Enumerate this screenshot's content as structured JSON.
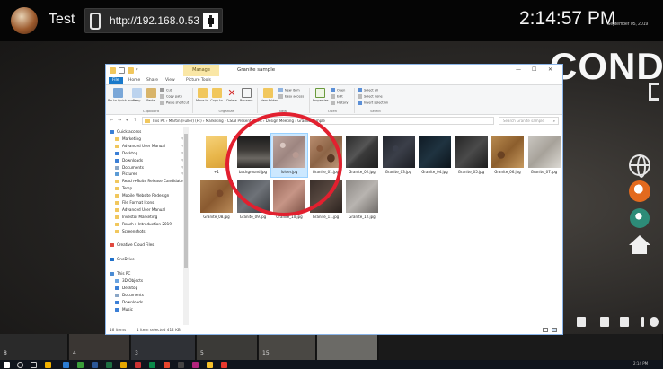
{
  "kiosk": {
    "title": "Test",
    "url": "http://192.168.0.53",
    "clock": "2:14:57 PM",
    "date": "September 05, 2019",
    "brand_text": "COND",
    "icons": {
      "logo": "brand-logo-icon",
      "phone": "phone-icon",
      "qr": "qr-code-icon",
      "globe": "globe-icon",
      "home": "home-icon"
    }
  },
  "thumbstrip": {
    "numbers": [
      "8",
      "4",
      "3",
      "5",
      "15"
    ]
  },
  "taskbar": {
    "time": "2:14 PM"
  },
  "explorer": {
    "window_title": "Granite sample",
    "context_tab": "Manage",
    "ribbon_tabs": [
      "File",
      "Home",
      "Share",
      "View",
      "Picture Tools"
    ],
    "ribbon": {
      "pin_quick": "Pin to Quick access",
      "copy": "Copy",
      "paste": "Paste",
      "cut": "Cut",
      "copy_path": "Copy path",
      "paste_shortcut": "Paste shortcut",
      "move_to": "Move to",
      "copy_to": "Copy to",
      "delete": "Delete",
      "rename": "Rename",
      "new_folder": "New folder",
      "new_item": "New item",
      "easy_access": "Easy access",
      "properties": "Properties",
      "open": "Open",
      "edit": "Edit",
      "history": "History",
      "select_all": "Select all",
      "select_none": "Select none",
      "invert_selection": "Invert selection",
      "groups": [
        "Clipboard",
        "Organize",
        "New",
        "Open",
        "Select"
      ]
    },
    "address_path": "This PC  ›  Martin (Fuller) (H:)  ›  Marketing  ›  CSLB Presentations  ›  Design Meeting  ›  Granite sample",
    "search_placeholder": "Search Granite sample",
    "nav_items": [
      {
        "label": "Quick access",
        "type": "star"
      },
      {
        "label": "Marketing",
        "type": "folder"
      },
      {
        "label": "Advanced User Manual",
        "type": "folder"
      },
      {
        "label": "Desktop",
        "type": "desktop"
      },
      {
        "label": "Downloads",
        "type": "download"
      },
      {
        "label": "Documents",
        "type": "docs"
      },
      {
        "label": "Pictures",
        "type": "pictures"
      },
      {
        "label": "Reach+Suite Release Candidates",
        "type": "folder"
      },
      {
        "label": "Temp",
        "type": "folder"
      },
      {
        "label": "Mobile Website Redesign",
        "type": "folder"
      },
      {
        "label": "File Format Icons",
        "type": "folder"
      },
      {
        "label": "Advanced User Manual",
        "type": "folder"
      },
      {
        "label": "Investor Marketing",
        "type": "folder"
      },
      {
        "label": "Reach+ Introduction 2019",
        "type": "folder"
      },
      {
        "label": "Screenshots",
        "type": "folder"
      },
      {
        "label": "",
        "type": "spacer"
      },
      {
        "label": "Creative Cloud Files",
        "type": "cloud"
      },
      {
        "label": "",
        "type": "spacer"
      },
      {
        "label": "OneDrive",
        "type": "onedrive"
      },
      {
        "label": "",
        "type": "spacer"
      },
      {
        "label": "This PC",
        "type": "pc"
      },
      {
        "label": "3D Objects",
        "type": "obj3d"
      },
      {
        "label": "Desktop",
        "type": "desktop"
      },
      {
        "label": "Documents",
        "type": "docs"
      },
      {
        "label": "Downloads",
        "type": "download"
      },
      {
        "label": "Music",
        "type": "music"
      }
    ],
    "files": [
      {
        "name": "+1",
        "kind": "folder"
      },
      {
        "name": "background.jpg",
        "kind": "background"
      },
      {
        "name": "folder.jpg",
        "kind": "g-folder",
        "selected": true
      },
      {
        "name": "Granite_01.jpg",
        "kind": "g01"
      },
      {
        "name": "Granite_02.jpg",
        "kind": "g02"
      },
      {
        "name": "Granite_03.jpg",
        "kind": "g03"
      },
      {
        "name": "Granite_04.jpg",
        "kind": "g04"
      },
      {
        "name": "Granite_05.jpg",
        "kind": "g05"
      },
      {
        "name": "Granite_06.jpg",
        "kind": "g06"
      },
      {
        "name": "Granite_07.jpg",
        "kind": "g07"
      },
      {
        "name": "Granite_08.jpg",
        "kind": "g08"
      },
      {
        "name": "Granite_09.jpg",
        "kind": "g09"
      },
      {
        "name": "Granite_10.jpg",
        "kind": "g10"
      },
      {
        "name": "Granite_11.jpg",
        "kind": "g11"
      },
      {
        "name": "Granite_12.jpg",
        "kind": "g12"
      }
    ],
    "status": {
      "item_count": "16 items",
      "selection": "1 item selected  412 KB"
    }
  },
  "colors": {
    "annotation_red": "#e2202f",
    "selection_blue": "#cce8ff",
    "file_tab_blue": "#1979ca",
    "manage_tab": "#fae7a6"
  }
}
